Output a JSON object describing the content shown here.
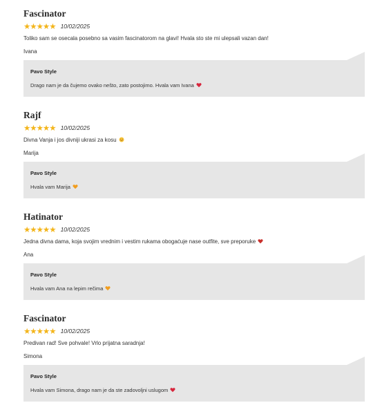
{
  "reviews": [
    {
      "title": "Fascinator",
      "stars": "★★★★★",
      "rating": 5,
      "date": "10/02/2025",
      "text": "Toliko sam se osecala posebno sa vasim fascinatorom na glavi! Hvala sto ste mi ulepsali vazan dan!",
      "text_emoji": "",
      "author": "Ivana",
      "reply_author": "Pavo Style",
      "reply_text": "Drago nam je da čujemo ovako nešto, zato postojimo. Hvala vam Ivana",
      "reply_emoji": "red-heart-icon",
      "reply_emoji_color": "#d7263d"
    },
    {
      "title": "Rajf",
      "stars": "★★★★★",
      "rating": 5,
      "date": "10/02/2025",
      "text": "Divna Vanja i jos divniji ukrasi za kosu",
      "text_emoji": "smile-emoji-icon",
      "text_emoji_color": "#f7c43a",
      "author": "Marija",
      "reply_author": "Pavo Style",
      "reply_text": "Hvala vam Marija",
      "reply_emoji": "orange-heart-icon",
      "reply_emoji_color": "#f29d1e"
    },
    {
      "title": "Hatinator",
      "stars": "★★★★★",
      "rating": 5,
      "date": "10/02/2025",
      "text": "Jedna divna dama, koja svojim vrednim i vestim rukama obogaćuje nase outfite, sve preporuke",
      "text_emoji": "red-heart-icon",
      "text_emoji_color": "#c9302c",
      "author": "Ana",
      "reply_author": "Pavo Style",
      "reply_text": "Hvala vam Ana na lepim rečima",
      "reply_emoji": "orange-heart-icon",
      "reply_emoji_color": "#f29d1e"
    },
    {
      "title": "Fascinator",
      "stars": "★★★★★",
      "rating": 5,
      "date": "10/02/2025",
      "text": "Predivan rad! Sve pohvale! Vrlo prijatna saradnja!",
      "text_emoji": "",
      "author": "Simona",
      "reply_author": "Pavo Style",
      "reply_text": "Hvala vam Simona, drago nam je da ste zadovoljni uslugom",
      "reply_emoji": "red-heart-icon",
      "reply_emoji_color": "#d7263d"
    }
  ],
  "colors": {
    "star": "#f3b51b",
    "reply_background": "#e6e6e6"
  }
}
